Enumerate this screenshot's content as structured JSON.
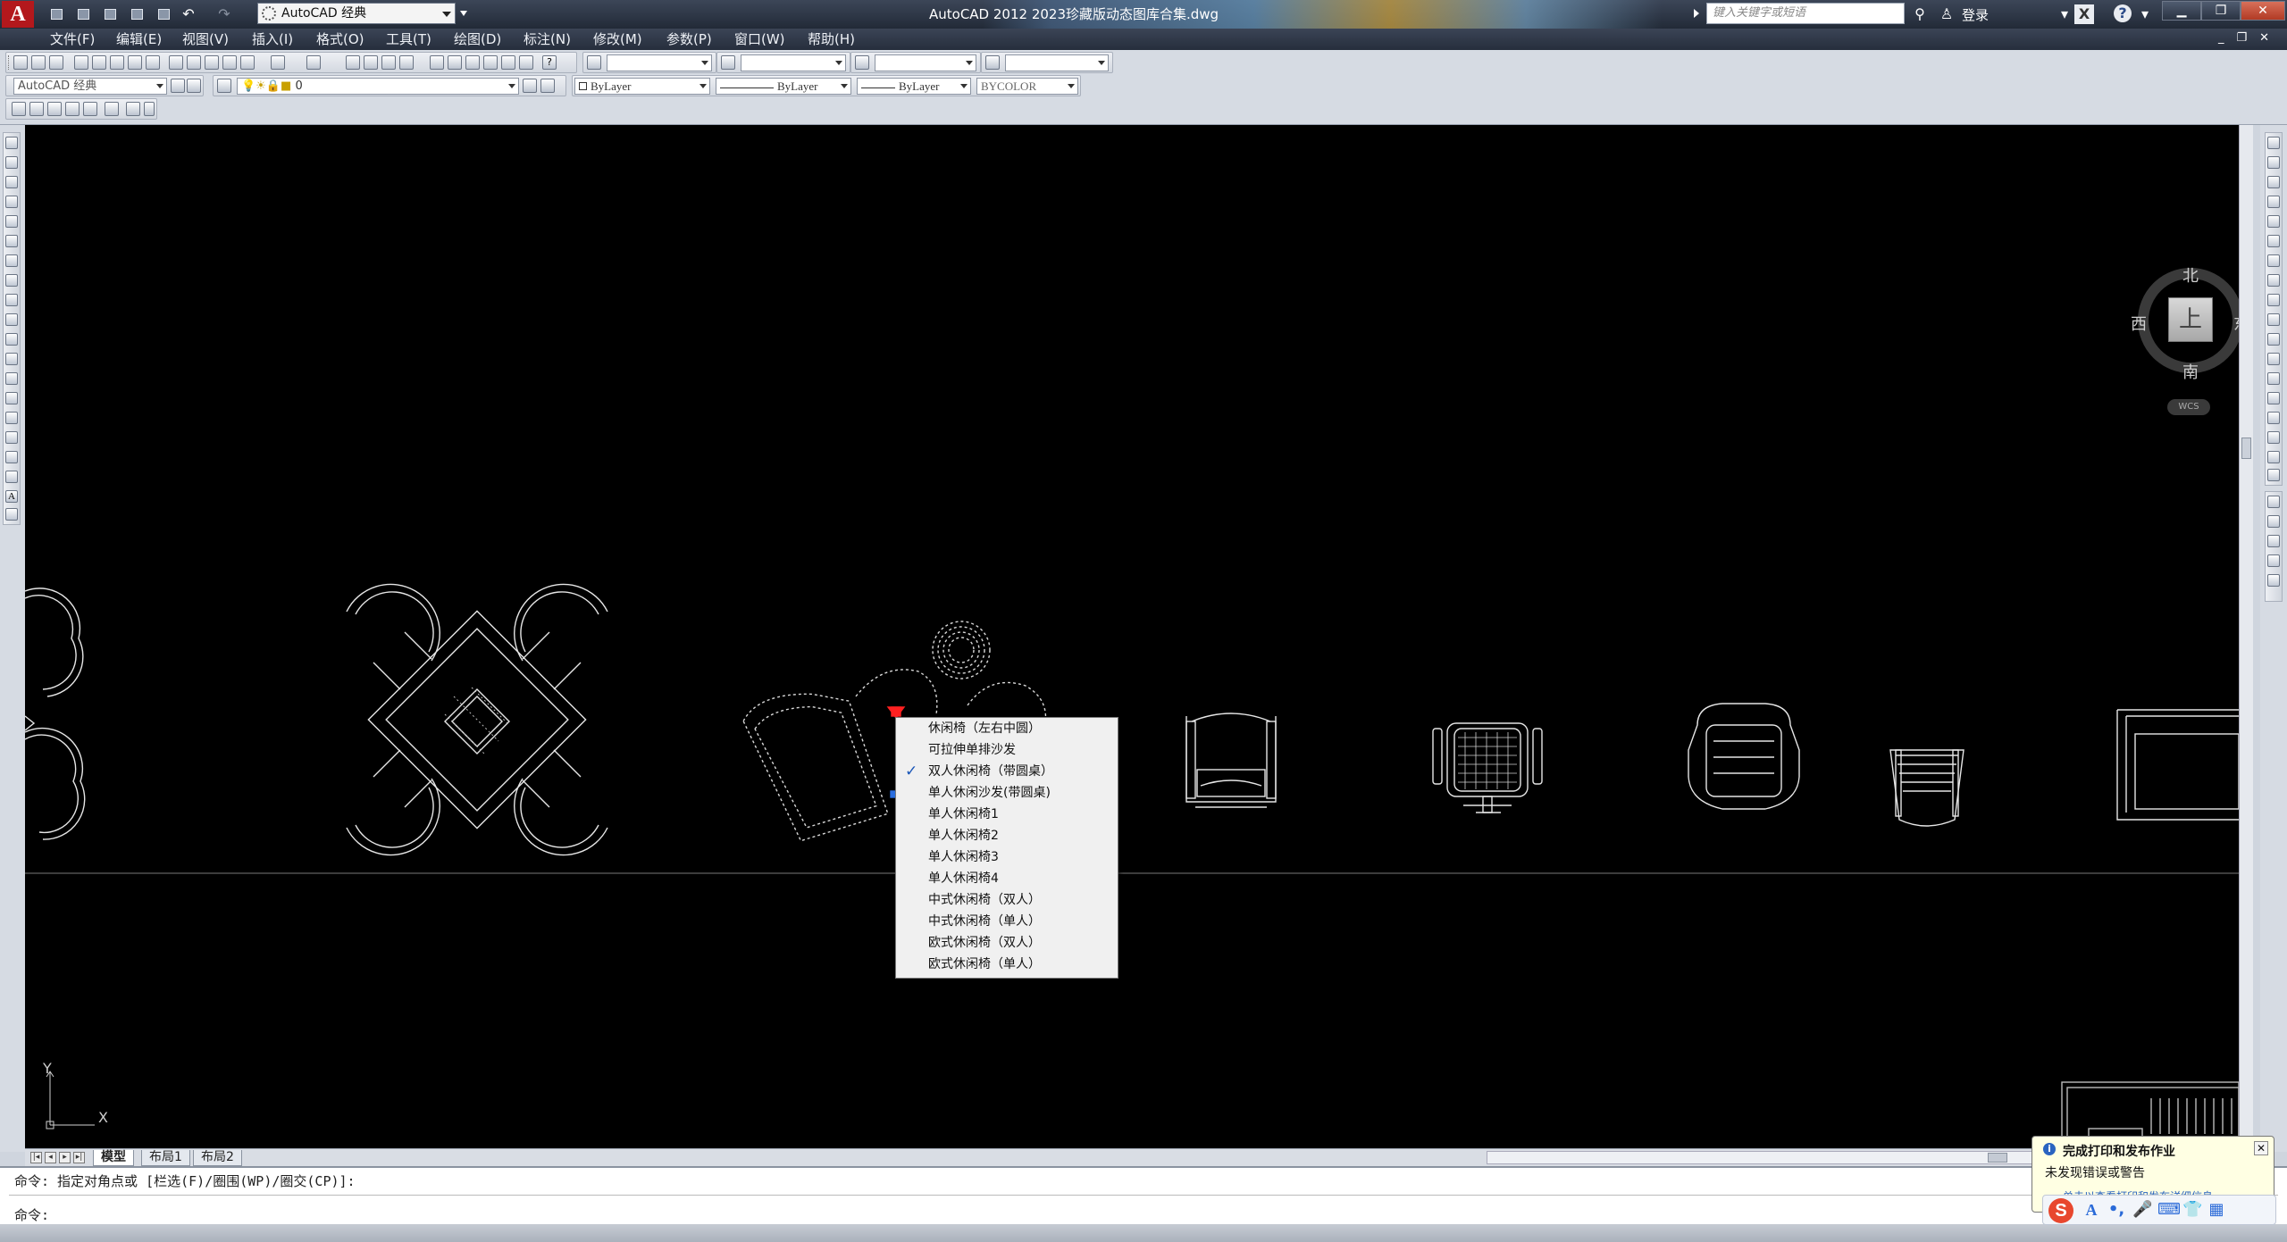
{
  "title_bar": {
    "app_title": "AutoCAD 2012    2023珍藏版动态图库合集.dwg",
    "workspace": "AutoCAD 经典",
    "search_placeholder": "键入关键字或短语",
    "login_label": "登录",
    "app_logo": "A"
  },
  "menu": {
    "items": [
      "文件(F)",
      "编辑(E)",
      "视图(V)",
      "插入(I)",
      "格式(O)",
      "工具(T)",
      "绘图(D)",
      "标注(N)",
      "修改(M)",
      "参数(P)",
      "窗口(W)",
      "帮助(H)"
    ]
  },
  "toolbars": {
    "workspace_combo": "AutoCAD 经典",
    "layer_combo": "0",
    "color_combo": "ByLayer",
    "linetype_combo": "ByLayer",
    "lineweight_combo": "ByLayer",
    "plotstyle_combo": "BYCOLOR"
  },
  "context_menu": {
    "items": [
      {
        "label": "休闲椅（左右中圆）",
        "checked": false
      },
      {
        "label": "可拉伸单排沙发",
        "checked": false
      },
      {
        "label": "双人休闲椅（带圆桌）",
        "checked": true
      },
      {
        "label": "单人休闲沙发(带圆桌)",
        "checked": false
      },
      {
        "label": "单人休闲椅1",
        "checked": false
      },
      {
        "label": "单人休闲椅2",
        "checked": false
      },
      {
        "label": "单人休闲椅3",
        "checked": false
      },
      {
        "label": "单人休闲椅4",
        "checked": false
      },
      {
        "label": "中式休闲椅（双人）",
        "checked": false
      },
      {
        "label": "中式休闲椅（单人）",
        "checked": false
      },
      {
        "label": "欧式休闲椅（双人）",
        "checked": false
      },
      {
        "label": "欧式休闲椅（单人）",
        "checked": false
      }
    ],
    "check_glyph": "✓"
  },
  "viewcube": {
    "north": "北",
    "south": "南",
    "east": "东",
    "west": "西",
    "face": "上",
    "wcs": "WCS"
  },
  "ucs": {
    "x_label": "X",
    "y_label": "Y"
  },
  "layout_tabs": [
    "模型",
    "布局1",
    "布局2"
  ],
  "command_line": {
    "history": "命令: 指定对角点或 [栏选(F)/圈围(WP)/圈交(CP)]:",
    "prompt": "命令:"
  },
  "notification": {
    "title": "完成打印和发布作业",
    "body": "未发现错误或警告",
    "link": "单击以查看打印和发布详细信息",
    "info_glyph": "i",
    "close_glyph": "✕"
  },
  "ime": {
    "logo": "S",
    "icons": [
      "A",
      "•,",
      "🎤",
      "⌨",
      "👕",
      "▦"
    ]
  },
  "colors": {
    "canvas": "#000000",
    "grip_red": "#ff2020",
    "grip_blue": "#2b6fe0",
    "title_bg": "#2c3444"
  }
}
